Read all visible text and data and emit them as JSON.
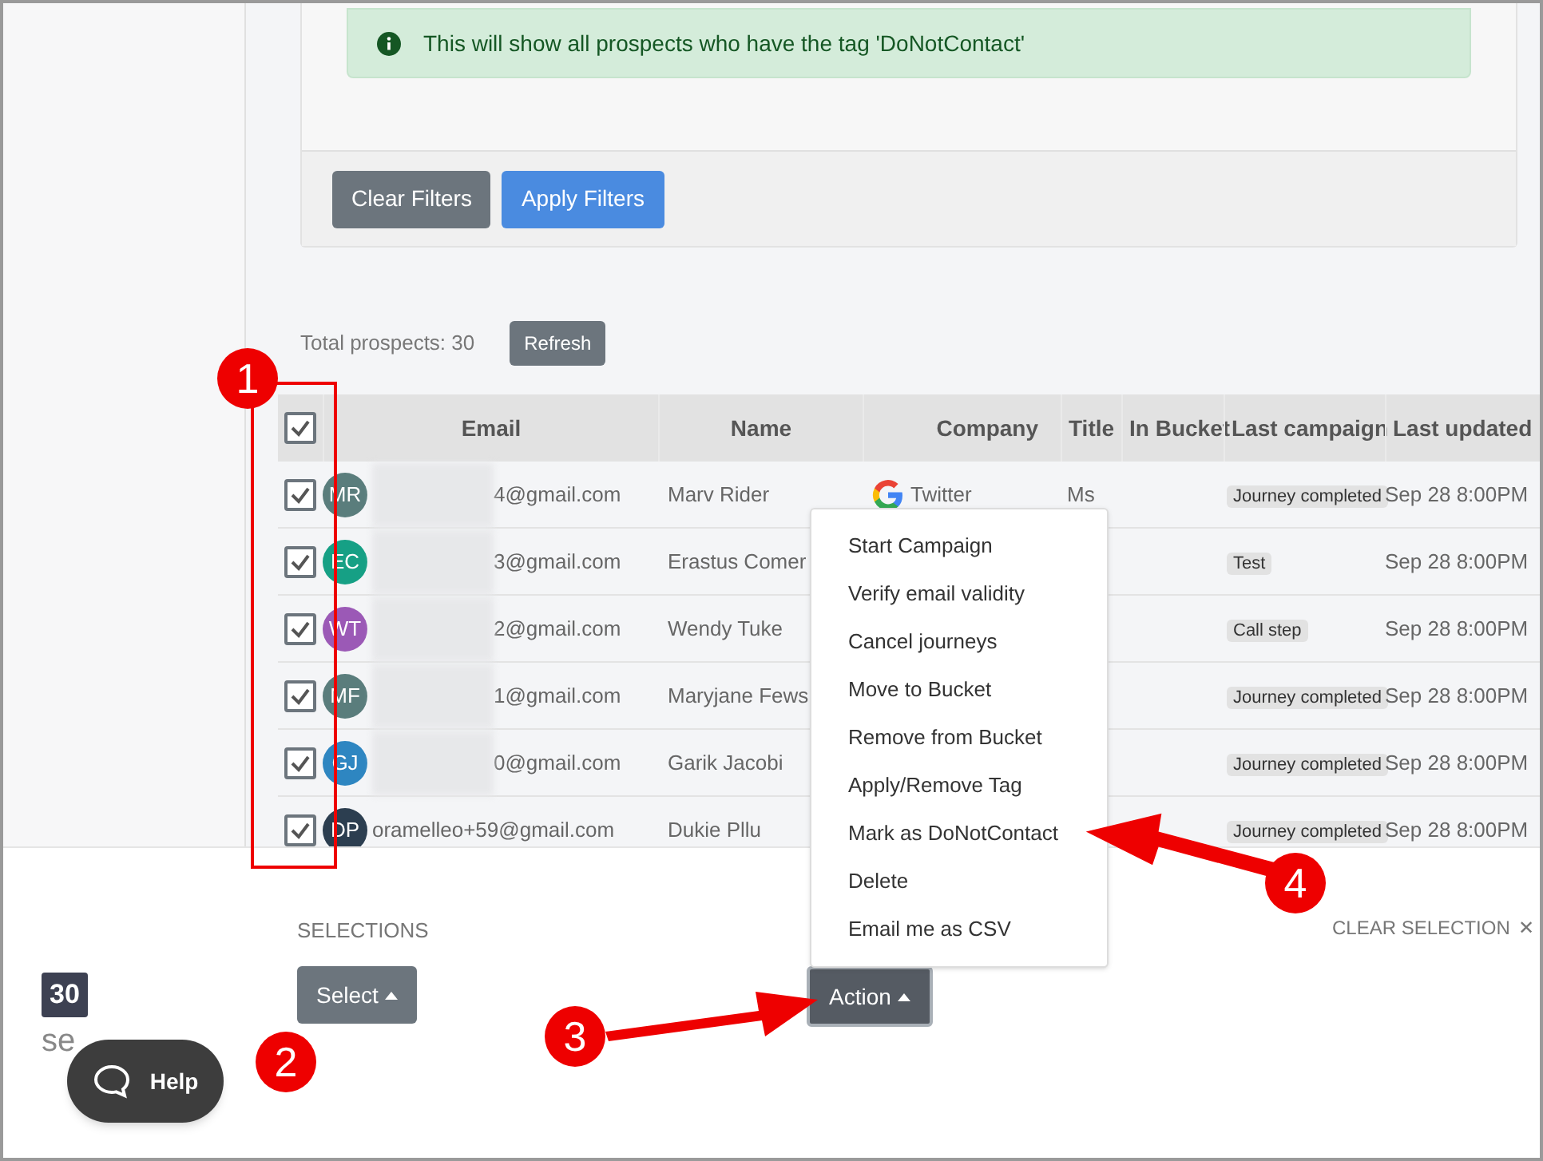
{
  "filter_panel": {
    "info": "This will show all prospects who have the tag 'DoNotContact'",
    "buttons": [
      {
        "label": "Clear Filters",
        "kind": "secondary"
      },
      {
        "label": "Apply Filters",
        "kind": "primary"
      }
    ]
  },
  "summary": {
    "total": "Total prospects: 30",
    "refresh": "Refresh"
  },
  "table": {
    "header_checked": true,
    "columns": [
      "Email",
      "Name",
      "Company",
      "Title",
      "In Bucket",
      "Last campaign",
      "Last updated"
    ],
    "rows": [
      {
        "checked": true,
        "initials": "MR",
        "color": "#5a7d7c",
        "email": "4@gmail.com",
        "name": "Marv Rider",
        "company": "Twitter",
        "title": "Ms",
        "campaign": "Journey completed",
        "updated": "Sep 28 8:00PM"
      },
      {
        "checked": true,
        "initials": "EC",
        "color": "#16a085",
        "email": "3@gmail.com",
        "name": "Erastus Comer",
        "campaign": "Test",
        "updated": "Sep 28 8:00PM"
      },
      {
        "checked": true,
        "initials": "WT",
        "color": "#9b59b6",
        "email": "2@gmail.com",
        "name": "Wendy Tuke",
        "campaign": "Call step",
        "updated": "Sep 28 8:00PM"
      },
      {
        "checked": true,
        "initials": "MF",
        "color": "#5a7d7c",
        "email": "1@gmail.com",
        "name": "Maryjane Fews",
        "campaign": "Journey completed",
        "updated": "Sep 28 8:00PM"
      },
      {
        "checked": true,
        "initials": "GJ",
        "color": "#2e86c1",
        "email": "0@gmail.com",
        "name": "Garik Jacobi",
        "campaign": "Journey completed",
        "updated": "Sep 28 8:00PM"
      },
      {
        "checked": true,
        "initials": "DP",
        "color": "#2c3e50",
        "email": "oramelleo+59@gmail.com",
        "name": "Dukie Pllu",
        "campaign": "Journey completed",
        "updated": "Sep 28 8:00PM"
      }
    ]
  },
  "action_menu": [
    "Start Campaign",
    "Verify email validity",
    "Cancel journeys",
    "Move to Bucket",
    "Remove from Bucket",
    "Apply/Remove Tag",
    "Mark as DoNotContact",
    "Delete",
    "Email me as CSV"
  ],
  "footer": {
    "count": "30",
    "count_label": "se",
    "selections_label": "SELECTIONS",
    "select_button": "Select",
    "action_button": "Action",
    "clear_selection": "CLEAR SELECTION",
    "clear_icon": "✕",
    "help": "Help"
  },
  "annotations": [
    "1",
    "2",
    "3",
    "4"
  ]
}
